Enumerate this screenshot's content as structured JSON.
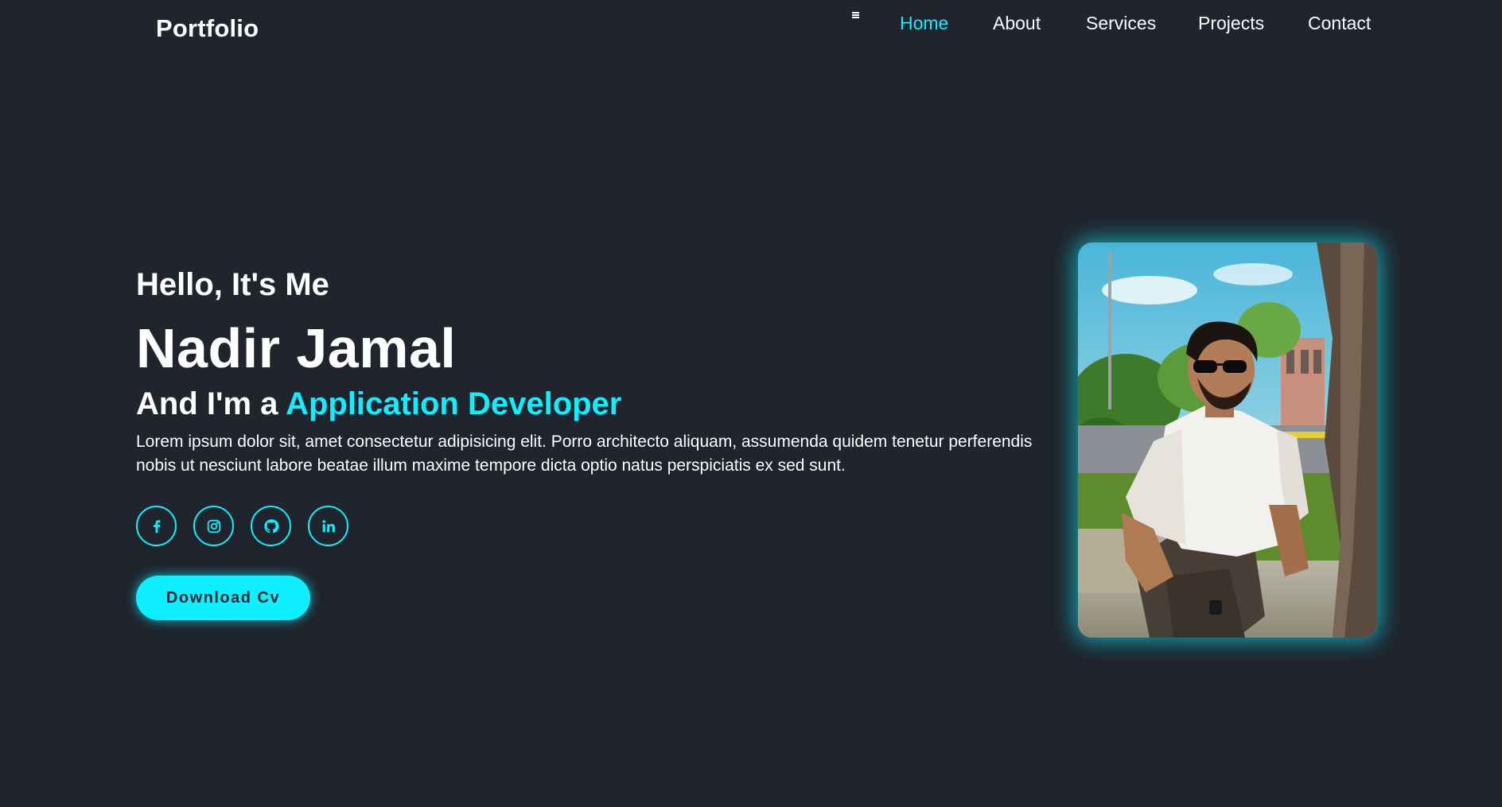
{
  "header": {
    "logo": "Portfolio",
    "menu_icon": "hamburger-menu-icon",
    "nav": [
      {
        "label": "Home",
        "active": true
      },
      {
        "label": "About",
        "active": false
      },
      {
        "label": "Services",
        "active": false
      },
      {
        "label": "Projects",
        "active": false
      },
      {
        "label": "Contact",
        "active": false
      }
    ]
  },
  "hero": {
    "greeting": "Hello, It's Me",
    "name": "Nadir Jamal",
    "role_prefix": "And I'm a",
    "role": "Application Developer",
    "bio": "Lorem ipsum dolor sit, amet consectetur adipisicing elit. Porro architecto aliquam, assumenda quidem tenetur perferendis nobis ut nesciunt labore beatae illum maxime tempore dicta optio natus perspiciatis ex sed sunt.",
    "socials": [
      {
        "icon": "facebook-icon"
      },
      {
        "icon": "instagram-icon"
      },
      {
        "icon": "github-icon"
      },
      {
        "icon": "linkedin-icon"
      }
    ],
    "cv_button": "Download Cv",
    "photo_icon": "profile-photo"
  },
  "colors": {
    "background": "#1f242d",
    "accent": "#0ef0ff",
    "text": "#ffffff"
  }
}
